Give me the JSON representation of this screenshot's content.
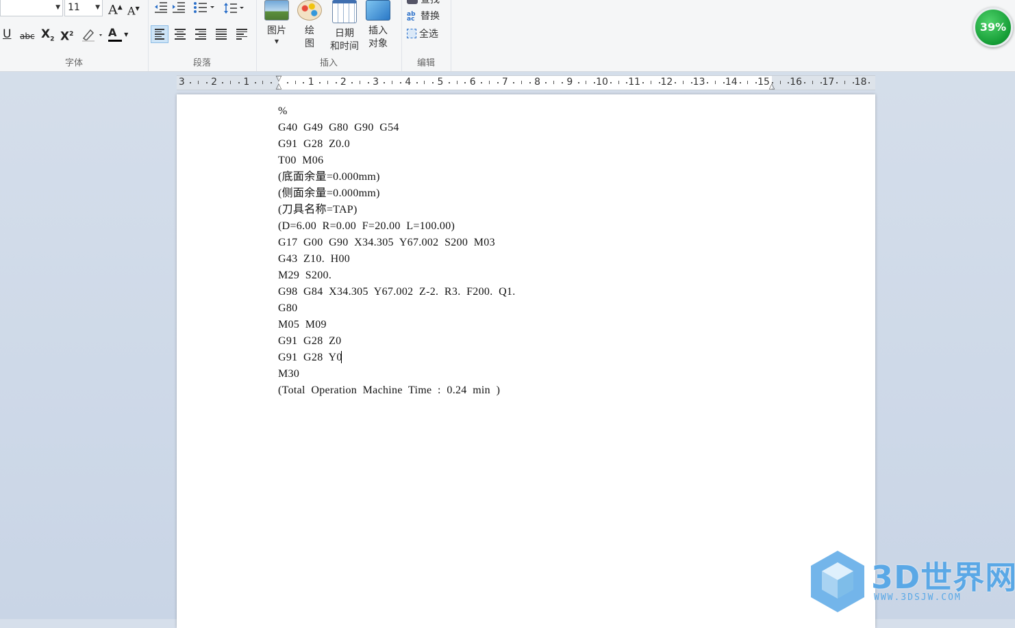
{
  "ribbon": {
    "font_group": {
      "label": "字体",
      "font_size": "11",
      "grow_font": "A",
      "shrink_font": "A",
      "underline": "U",
      "strikethrough": "abc",
      "subscript": "X",
      "superscript": "X",
      "font_color": "A"
    },
    "paragraph_group": {
      "label": "段落"
    },
    "insert_group": {
      "label": "插入",
      "picture": "图片",
      "paint_1": "绘",
      "paint_2": "图",
      "datetime_1": "日期",
      "datetime_2": "和时间",
      "object_1": "插入",
      "object_2": "对象"
    },
    "edit_group": {
      "label": "编辑",
      "find": "查找",
      "replace": "替换",
      "select_all": "全选"
    }
  },
  "zoom": {
    "label": "39%",
    "value_percent": 39
  },
  "ruler": {
    "labels": [
      "3",
      "2",
      "1",
      "1",
      "2",
      "3",
      "4",
      "5",
      "6",
      "7",
      "8",
      "9",
      "10",
      "11",
      "12",
      "13",
      "14",
      "15",
      "16",
      "17",
      "18"
    ]
  },
  "document": {
    "lines": [
      "%",
      "G40  G49  G80  G90  G54",
      "G91  G28  Z0.0",
      "T00  M06",
      "(底面余量=0.000mm)",
      "(侧面余量=0.000mm)",
      "(刀具名称=TAP)",
      "(D=6.00  R=0.00  F=20.00  L=100.00)",
      "G17  G00  G90  X34.305  Y67.002  S200  M03",
      "G43  Z10.  H00",
      "M29  S200.",
      "G98  G84  X34.305  Y67.002  Z-2.  R3.  F200.  Q1.",
      "G80",
      "M05  M09",
      "G91  G28  Z0",
      "G91  G28  Y0",
      "M30",
      "(Total  Operation  Machine  Time  :  0.24  min  )"
    ]
  },
  "watermark": {
    "brand": "3D世界网",
    "url": "WWW.3DSJW.COM",
    "color": "#5aa8e6"
  }
}
